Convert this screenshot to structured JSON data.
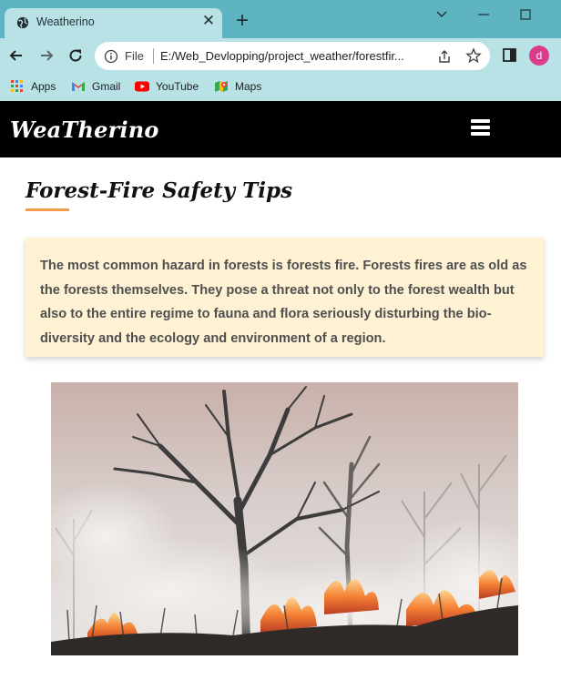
{
  "browser": {
    "tab_title": "Weatherino",
    "url_scheme": "File",
    "url": "E:/Web_Devlopping/project_weather/forestfir...",
    "profile_initial": "d",
    "bookmarks": [
      {
        "label": "Apps",
        "icon": "apps-grid-icon"
      },
      {
        "label": "Gmail",
        "icon": "gmail-icon"
      },
      {
        "label": "YouTube",
        "icon": "youtube-icon"
      },
      {
        "label": "Maps",
        "icon": "maps-icon"
      }
    ]
  },
  "site": {
    "logo": "WeaTherino",
    "menu_icon": "hamburger-menu-icon"
  },
  "page": {
    "title": "Forest-Fire Safety Tips",
    "intro_lines": [
      "The most common hazard in forests is forests fire. Forests fires are as old",
      "as the forests themselves. They pose a threat not only to the forest wealth",
      "but also to the entire regime to fauna and flora seriously disturbing the bio-",
      "diversity and the ecology and environment of a region."
    ],
    "photo": "forest-fire-photo"
  },
  "colors": {
    "chrome_bg": "#5eb4c1",
    "chrome_light": "#b8e2e6",
    "header_bg": "#000000",
    "accent_underline": "#f2994a",
    "card_bg": "#fff1d3"
  }
}
